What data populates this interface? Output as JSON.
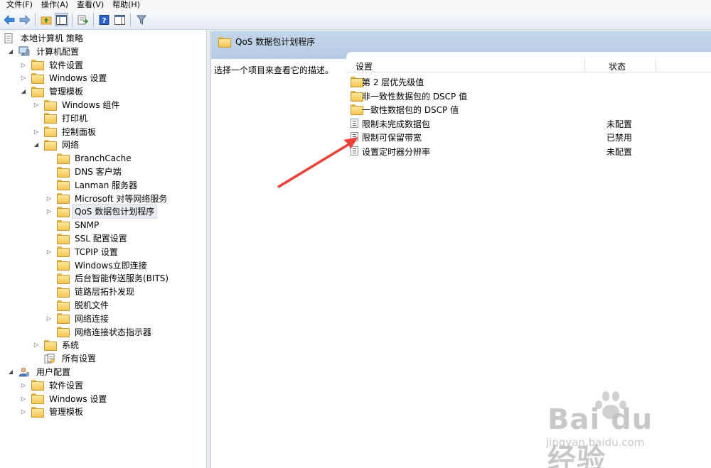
{
  "menu": [
    {
      "label": "文件(F)"
    },
    {
      "label": "操作(A)"
    },
    {
      "label": "查看(V)"
    },
    {
      "label": "帮助(H)"
    }
  ],
  "tree": [
    {
      "label": "本地计算机 策略",
      "level": 0,
      "icon": "policy-document-icon",
      "expander": ""
    },
    {
      "label": "计算机配置",
      "level": 1,
      "icon": "computer-icon",
      "expander": "open"
    },
    {
      "label": "软件设置",
      "level": 2,
      "icon": "folder-icon",
      "expander": "closed"
    },
    {
      "label": "Windows 设置",
      "level": 2,
      "icon": "folder-icon",
      "expander": "closed"
    },
    {
      "label": "管理模板",
      "level": 2,
      "icon": "folder-icon",
      "expander": "open"
    },
    {
      "label": "Windows 组件",
      "level": 3,
      "icon": "folder-icon",
      "expander": "closed"
    },
    {
      "label": "打印机",
      "level": 3,
      "icon": "folder-icon",
      "expander": ""
    },
    {
      "label": "控制面板",
      "level": 3,
      "icon": "folder-icon",
      "expander": "closed"
    },
    {
      "label": "网络",
      "level": 3,
      "icon": "folder-icon",
      "expander": "open"
    },
    {
      "label": "BranchCache",
      "level": 4,
      "icon": "folder-icon",
      "expander": ""
    },
    {
      "label": "DNS 客户端",
      "level": 4,
      "icon": "folder-icon",
      "expander": ""
    },
    {
      "label": "Lanman 服务器",
      "level": 4,
      "icon": "folder-icon",
      "expander": ""
    },
    {
      "label": "Microsoft 对等网络服务",
      "level": 4,
      "icon": "folder-icon",
      "expander": "closed"
    },
    {
      "label": "QoS 数据包计划程序",
      "level": 4,
      "icon": "folder-icon",
      "expander": "closed",
      "selected": true
    },
    {
      "label": "SNMP",
      "level": 4,
      "icon": "folder-icon",
      "expander": ""
    },
    {
      "label": "SSL 配置设置",
      "level": 4,
      "icon": "folder-icon",
      "expander": ""
    },
    {
      "label": "TCPIP 设置",
      "level": 4,
      "icon": "folder-icon",
      "expander": "closed"
    },
    {
      "label": "Windows立即连接",
      "level": 4,
      "icon": "folder-icon",
      "expander": ""
    },
    {
      "label": "后台智能传送服务(BITS)",
      "level": 4,
      "icon": "folder-icon",
      "expander": ""
    },
    {
      "label": "链路层拓扑发现",
      "level": 4,
      "icon": "folder-icon",
      "expander": ""
    },
    {
      "label": "脱机文件",
      "level": 4,
      "icon": "folder-icon",
      "expander": ""
    },
    {
      "label": "网络连接",
      "level": 4,
      "icon": "folder-icon",
      "expander": "closed"
    },
    {
      "label": "网络连接状态指示器",
      "level": 4,
      "icon": "folder-icon",
      "expander": ""
    },
    {
      "label": "系统",
      "level": 3,
      "icon": "folder-icon",
      "expander": "closed"
    },
    {
      "label": "所有设置",
      "level": 3,
      "icon": "all-settings-icon",
      "expander": ""
    },
    {
      "label": "用户配置",
      "level": 1,
      "icon": "user-icon",
      "expander": "open"
    },
    {
      "label": "软件设置",
      "level": 2,
      "icon": "folder-icon",
      "expander": "closed"
    },
    {
      "label": "Windows 设置",
      "level": 2,
      "icon": "folder-icon",
      "expander": "closed"
    },
    {
      "label": "管理模板",
      "level": 2,
      "icon": "folder-icon",
      "expander": "closed"
    }
  ],
  "right": {
    "title": "QoS 数据包计划程序",
    "description": "选择一个项目来查看它的描述。",
    "columns": {
      "setting": "设置",
      "state": "状态"
    },
    "rows": [
      {
        "name": "第 2 层优先级值",
        "state": "",
        "icon": "folder-icon"
      },
      {
        "name": "非一致性数据包的 DSCP 值",
        "state": "",
        "icon": "folder-icon"
      },
      {
        "name": "一致性数据包的 DSCP 值",
        "state": "",
        "icon": "folder-icon"
      },
      {
        "name": "限制未完成数据包",
        "state": "未配置",
        "icon": "policy-setting-icon"
      },
      {
        "name": "限制可保留带宽",
        "state": "已禁用",
        "icon": "policy-setting-icon"
      },
      {
        "name": "设置定时器分辨率",
        "state": "未配置",
        "icon": "policy-setting-icon"
      }
    ]
  },
  "colors": {
    "annotation_arrow": "#e8443a",
    "header_band": "#b9cde5",
    "folder": "#f4c556"
  },
  "watermark": {
    "main": "Bai du 经验",
    "sub": "jingyan.baidu.com"
  }
}
